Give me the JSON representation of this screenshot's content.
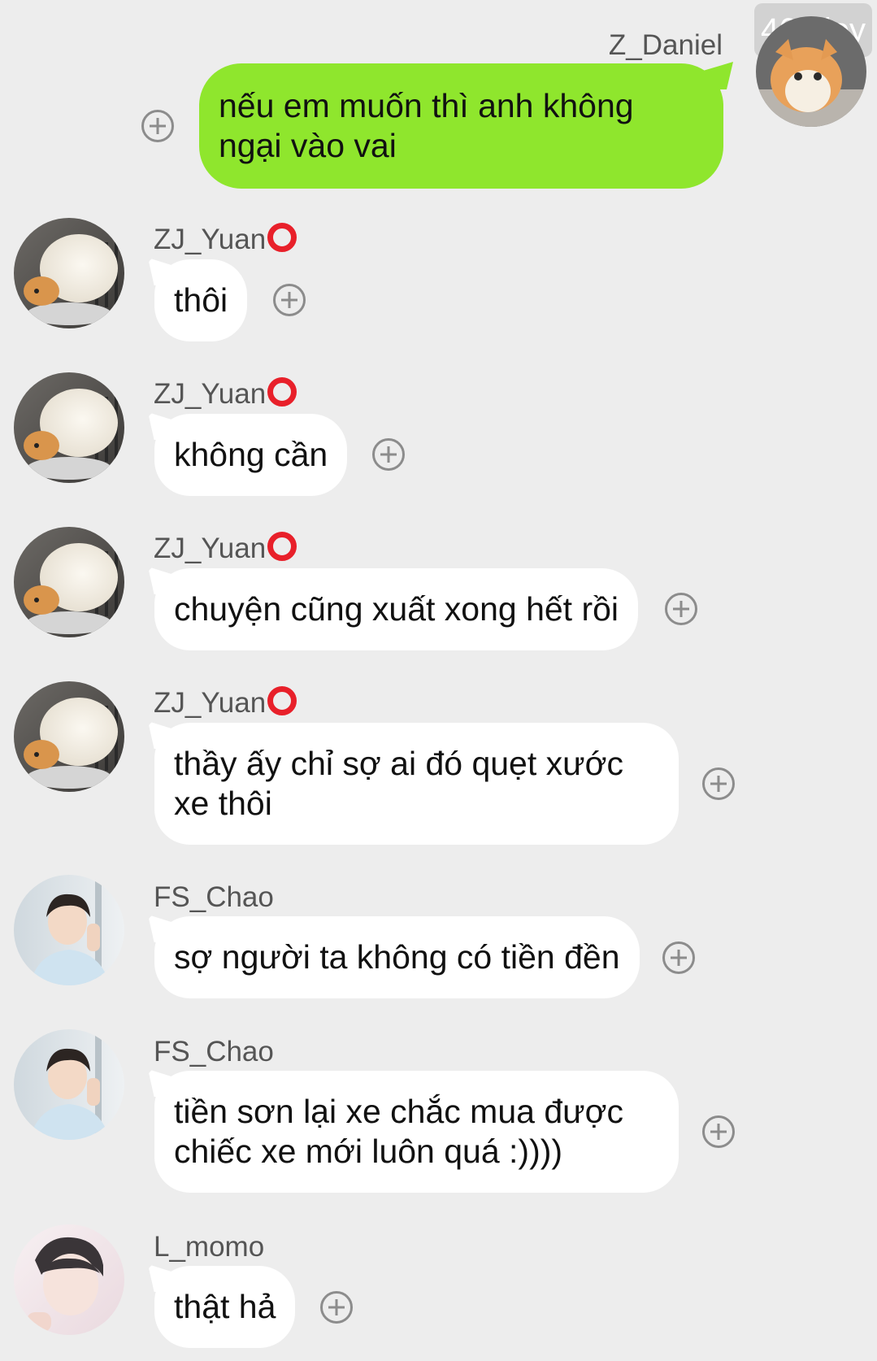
{
  "joy_badge": "461 joy",
  "messages": [
    {
      "sender": "Z_Daniel",
      "text": "nếu em muốn thì anh không ngại vào vai",
      "mine": true
    },
    {
      "sender": "ZJ_Yuan",
      "text": "thôi"
    },
    {
      "sender": "ZJ_Yuan",
      "text": "không cần"
    },
    {
      "sender": "ZJ_Yuan",
      "text": "chuyện cũng xuất xong hết rồi"
    },
    {
      "sender": "ZJ_Yuan",
      "text": "thầy ấy chỉ sợ ai đó quẹt xước xe thôi"
    },
    {
      "sender": "FS_Chao",
      "text": "sợ người ta không có tiền đền"
    },
    {
      "sender": "FS_Chao",
      "text": "tiền sơn lại xe chắc mua  được chiếc xe mới luôn quá :))))"
    },
    {
      "sender": "L_momo",
      "text": "thật hả"
    }
  ],
  "icons": {
    "add": "plus-circle-icon",
    "status": "red-ring-icon"
  },
  "colors": {
    "background": "#ededed",
    "my_bubble": "#8fe62d",
    "other_bubble": "#ffffff",
    "status_ring": "#e8202a"
  }
}
